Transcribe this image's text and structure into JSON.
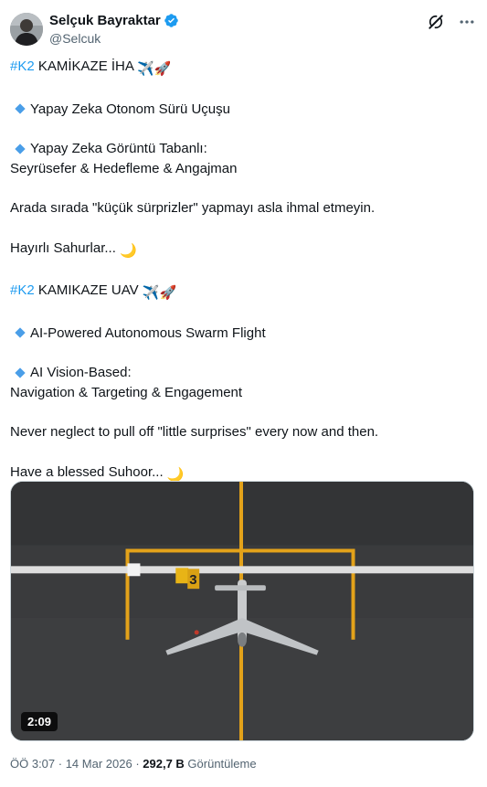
{
  "author": {
    "display_name": "Selçuk Bayraktar",
    "handle": "@Selcuk",
    "avatar_icon": "avatar-photo",
    "verified_icon": "verified-badge-icon"
  },
  "header_actions": {
    "grok_icon": "grok-icon",
    "more_icon": "more-dots-icon"
  },
  "tweet": {
    "tr": {
      "hashtag": "#K2",
      "title": " KAMİKAZE İHA ",
      "bullet1": "Yapay Zeka Otonom Sürü Uçuşu",
      "bullet2_line1": "Yapay Zeka Görüntü Tabanlı:",
      "bullet2_line2": "Seyrüsefer & Hedefleme & Angajman",
      "surprise": "Arada sırada \"küçük sürprizler\" yapmayı asla ihmal etmeyin.",
      "blessing": "Hayırlı Sahurlar... "
    },
    "en": {
      "hashtag": "#K2",
      "title": " KAMIKAZE UAV ",
      "bullet1": "AI-Powered Autonomous Swarm Flight",
      "bullet2_line1": "AI Vision-Based:",
      "bullet2_line2": "Navigation & Targeting & Engagement",
      "surprise": "Never neglect to pull off \"little surprises\" every now and then.",
      "blessing": "Have a blessed Suhoor... "
    },
    "emojis": {
      "plane": "✈️",
      "rocket": "🚀",
      "moon": "🌙"
    }
  },
  "media": {
    "duration": "2:09",
    "marker_label": "3",
    "colors": {
      "tarmac": "#3b3c3e",
      "line_yellow": "#e6a51c",
      "line_white": "#e3e3e3"
    }
  },
  "footer": {
    "time": "ÖÖ 3:07",
    "separator": " · ",
    "date": "14 Mar 2026",
    "views_count": "292,7 B",
    "views_label": " Görüntüleme"
  }
}
